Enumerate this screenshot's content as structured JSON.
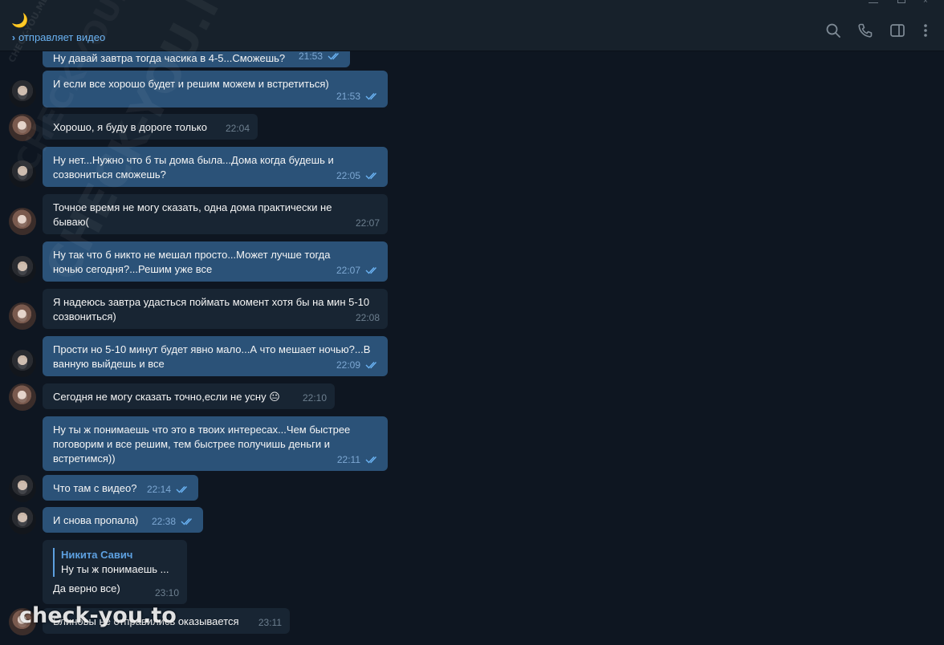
{
  "header": {
    "chat_emoji": "🌙",
    "status": "отправляет видео"
  },
  "watermarks": {
    "diagonal": "CHECK-YOU.ME",
    "diagonal_small": "CHECK-YOU.ME",
    "bottom": "check-you.to"
  },
  "colors": {
    "background": "#0e1621",
    "header": "#17212b",
    "outgoing_bubble": "#2b5278",
    "incoming_bubble": "#182533",
    "accent": "#6ab2f2"
  },
  "icons": {
    "search": "search-icon",
    "call": "phone-icon",
    "sidebar": "sidebar-toggle-icon",
    "more": "more-vertical-icon",
    "read": "double-check-icon"
  },
  "messages": [
    {
      "dir": "out",
      "text": "Ну давай завтра тогда часика в 4-5...Сможешь?",
      "time": "21:53",
      "read": true
    },
    {
      "dir": "out",
      "text": "И если все хорошо будет и решим можем и встретиться)",
      "time": "21:53",
      "read": true
    },
    {
      "dir": "in",
      "text": "Хорошо, я буду в дороге только",
      "time": "22:04"
    },
    {
      "dir": "out",
      "text": "Ну нет...Нужно что б ты дома была...Дома когда будешь и\nсозвониться сможешь?",
      "time": "22:05",
      "read": true
    },
    {
      "dir": "in",
      "text": "Точное время не могу сказать, одна дома практически не\nбываю(",
      "time": "22:07"
    },
    {
      "dir": "out",
      "text": "Ну так что б никто не мешал просто...Может лучше тогда\nночью сегодня?...Решим уже все",
      "time": "22:07",
      "read": true
    },
    {
      "dir": "in",
      "text": "Я надеюсь завтра удасться поймать момент хотя бы на мин 5-10\nсозвониться)",
      "time": "22:08"
    },
    {
      "dir": "out",
      "text": "Прости но 5-10 минут будет явно мало...А что мешает ночью?...В\nванную выйдешь и все",
      "time": "22:09",
      "read": true
    },
    {
      "dir": "in",
      "text": "Сегодня не могу сказать точно,если не усну",
      "emoji": "😐",
      "time": "22:10"
    },
    {
      "dir": "out",
      "text": "Ну ты ж понимаешь что это в твоих интересах...Чем быстрее\nпоговорим и все решим, тем быстрее получишь деньги и\nвстретимся))",
      "time": "22:11",
      "read": true
    },
    {
      "dir": "out",
      "text": "Что там с видео?",
      "time": "22:14",
      "read": true
    },
    {
      "dir": "out",
      "text": "И снова пропала)",
      "time": "22:38",
      "read": true
    },
    {
      "dir": "in",
      "reply_name": "Никита Савич",
      "reply_text": "Ну ты ж понимаешь ...",
      "text": "Да верно все)",
      "time": "23:10"
    },
    {
      "dir": "in",
      "text": "Блиновы не отправились оказывается",
      "time": "23:11"
    }
  ]
}
